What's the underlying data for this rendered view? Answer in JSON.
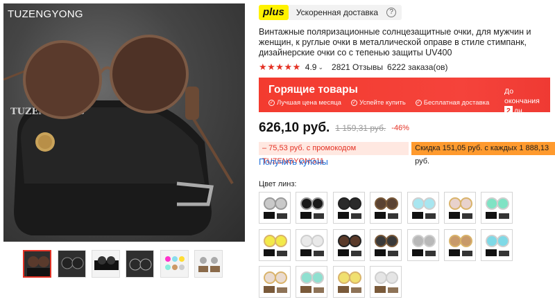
{
  "gallery": {
    "brand_overlay": "TUZENGYONG",
    "thumbnails": [
      {
        "name": "thumb-1",
        "selected": true,
        "theme": "dark"
      },
      {
        "name": "thumb-2",
        "selected": false,
        "theme": "dark"
      },
      {
        "name": "thumb-3",
        "selected": false,
        "theme": "light"
      },
      {
        "name": "thumb-4",
        "selected": false,
        "theme": "dark"
      },
      {
        "name": "thumb-5",
        "selected": false,
        "theme": "light"
      },
      {
        "name": "thumb-6",
        "selected": false,
        "theme": "light"
      }
    ]
  },
  "plus": {
    "badge": "plus",
    "delivery": "Ускоренная доставка",
    "help": "?"
  },
  "product": {
    "title": "Винтажные поляризационные солнцезащитные очки, для мужчин и женщин, к руглые очки в металлической оправе в стиле стимпанк, дизайнерские очки со с тепенью защиты UV400",
    "stars": "★★★★★",
    "rating": "4.9",
    "reviews": "2821 Отзывы",
    "orders": "6222 заказа(ов)"
  },
  "hot_deals": {
    "title": "Горящие товары",
    "features": [
      "Лучшая цена месяца",
      "Успейте купить",
      "Бесплатная доставка"
    ],
    "countdown_label": "До окончания",
    "countdown_value": "2",
    "countdown_unit": "дн."
  },
  "price": {
    "current": "626,10 руб.",
    "old": "1 159,31 руб.",
    "discount": "-46%"
  },
  "promo": {
    "code_offer": "– 75,53 руб. с промокодом TUZENGYONG11",
    "store_offer": "Скидка 151,05 руб. с каждых 1 888,13 руб."
  },
  "coupons_link": "Получить купоны",
  "color_label": "Цвет линз:",
  "colors": {
    "accent": "#e43225",
    "link": "#1e6fd9",
    "plus_yellow": "#fff200",
    "promo_orange": "#ff9a2e"
  },
  "swatches": [
    {
      "lens": "#c9c9c9",
      "frame": "#9a9a9a",
      "case": "#111111"
    },
    {
      "lens": "#1a1a1a",
      "frame": "#9a9a9a",
      "case": "#111111"
    },
    {
      "lens": "#2a2a2a",
      "frame": "#222222",
      "case": "#111111"
    },
    {
      "lens": "#5a4232",
      "frame": "#7a5a3a",
      "case": "#111111"
    },
    {
      "lens": "#a8e6f0",
      "frame": "#cfcfcf",
      "case": "#111111"
    },
    {
      "lens": "#e8d2cc",
      "frame": "#d9b36a",
      "case": "#111111"
    },
    {
      "lens": "#7fe3c4",
      "frame": "#cfcfcf",
      "case": "#111111"
    },
    {
      "lens": "#f3ea4a",
      "frame": "#d9b36a",
      "case": "#111111"
    },
    {
      "lens": "#e9e9e9",
      "frame": "#cfcfcf",
      "case": "#111111"
    },
    {
      "lens": "#5a3a2a",
      "frame": "#222222",
      "case": "#111111"
    },
    {
      "lens": "#3a3a3a",
      "frame": "#7a5a3a",
      "case": "#111111"
    },
    {
      "lens": "#b8b8b8",
      "frame": "#cfcfcf",
      "case": "#111111"
    },
    {
      "lens": "#c89a6a",
      "frame": "#d9b36a",
      "case": "#111111"
    },
    {
      "lens": "#7fd9e6",
      "frame": "#cfcfcf",
      "case": "#111111"
    },
    {
      "lens": "#eadbd0",
      "frame": "#d9b36a",
      "case": "#7a5a3a"
    },
    {
      "lens": "#8fe0d0",
      "frame": "#cfcfcf",
      "case": "#7a5a3a"
    },
    {
      "lens": "#f0e070",
      "frame": "#d9b36a",
      "case": "#7a5a3a"
    },
    {
      "lens": "#e5e5e5",
      "frame": "#cfcfcf",
      "case": "#7a5a3a"
    }
  ]
}
